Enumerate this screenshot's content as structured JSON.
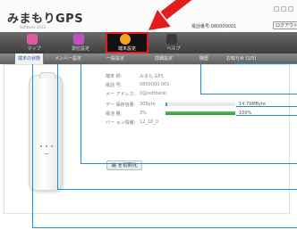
{
  "app": {
    "title": "みまもりGPS",
    "subtitle": "Softbank 2012"
  },
  "header": {
    "phone_label": "電話番号:080000001",
    "logout_label": "ログアウト"
  },
  "main_nav": {
    "items": [
      {
        "label": "マップ",
        "icon": "map-icon",
        "color": "#e05aa8"
      },
      {
        "label": "測位設定",
        "icon": "location-settings-icon",
        "color": "#c04fc4"
      },
      {
        "label": "端末設定",
        "icon": "device-settings-icon",
        "color": "#f3a41c",
        "active": true
      },
      {
        "label": "ヘルプ",
        "icon": "help-icon",
        "color": "#3a3a3a"
      }
    ]
  },
  "sub_nav": {
    "items": [
      {
        "label": "端末の状態",
        "active": true
      },
      {
        "label": "メンバー設定"
      },
      {
        "label": "一般設定"
      },
      {
        "label": "詳細設定"
      },
      {
        "label": "機歴"
      },
      {
        "label": "お知らせ (1/5)"
      }
    ]
  },
  "device_info": {
    "rows": [
      {
        "label": "端末 称:",
        "value": "みまも GPS"
      },
      {
        "label": "電話 号:",
        "value": "0800000 001"
      },
      {
        "label": "メー アドレス:",
        "value": "2@softbank."
      },
      {
        "label": "デー 保存容量:",
        "value": "30Byte"
      },
      {
        "label": "電池 量:",
        "value": "3%"
      },
      {
        "label": "バー ョン情報:",
        "value": "12_10_0"
      }
    ],
    "storage": {
      "fraction": 0.02,
      "text": "14.79MByte"
    },
    "battery": {
      "fraction": 1.0,
      "text": "100%"
    },
    "init_button_label": "端 を初期化"
  },
  "colors": {
    "accent_red": "#e41b1b",
    "callout_blue": "#1a8fd8",
    "progress_green": "#2e9a2e"
  }
}
